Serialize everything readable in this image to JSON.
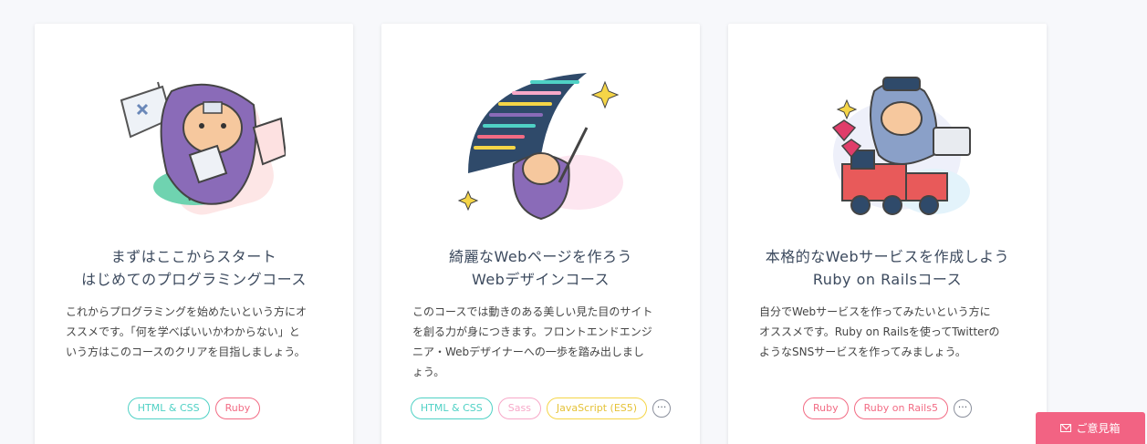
{
  "courses": [
    {
      "title_line1": "まずはここからスタート",
      "title_line2": "はじめてのプログラミングコース",
      "desc_lines": [
        "これからプログラミングを始めたいという方にオ",
        "ススメです。「何を学べばいいかわからない」と",
        "いう方はこのコースのクリアを目指しましょう。"
      ],
      "illustration_icon": "ninja-cat-with-flag-icon",
      "tags": [
        {
          "label": "HTML & CSS",
          "color": "#4fd1c5"
        },
        {
          "label": "Ruby",
          "color": "#f26b84"
        }
      ],
      "has_more": false
    },
    {
      "title_line1": "綺麗なWebページを作ろう",
      "title_line2": "Webデザインコース",
      "desc_lines": [
        "このコースでは動きのある美しい見た目のサイト",
        "を創る力が身につきます。フロントエンドエンジ",
        "ニア・Webデザイナーへの一歩を踏み出しまし",
        "ょう。"
      ],
      "illustration_icon": "ninja-cat-painting-wave-icon",
      "tags": [
        {
          "label": "HTML & CSS",
          "color": "#4fd1c5"
        },
        {
          "label": "Sass",
          "color": "#f7a8c8"
        },
        {
          "label": "JavaScript (ES5)",
          "color": "#f5d547"
        }
      ],
      "has_more": true
    },
    {
      "title_line1": "本格的なWebサービスを作成しよう",
      "title_line2": "Ruby on Railsコース",
      "desc_lines": [
        "自分でWebサービスを作ってみたいという方に",
        "オススメです。Ruby on Railsを使ってTwitterの",
        "ようなSNSサービスを作ってみましょう。"
      ],
      "illustration_icon": "ninja-cat-on-train-icon",
      "tags": [
        {
          "label": "Ruby",
          "color": "#f26b84"
        },
        {
          "label": "Ruby on Rails5",
          "color": "#f26b84"
        }
      ],
      "has_more": true
    }
  ],
  "more_label": "···",
  "feedback": {
    "label": "ご意見箱",
    "color": "#f26383"
  }
}
